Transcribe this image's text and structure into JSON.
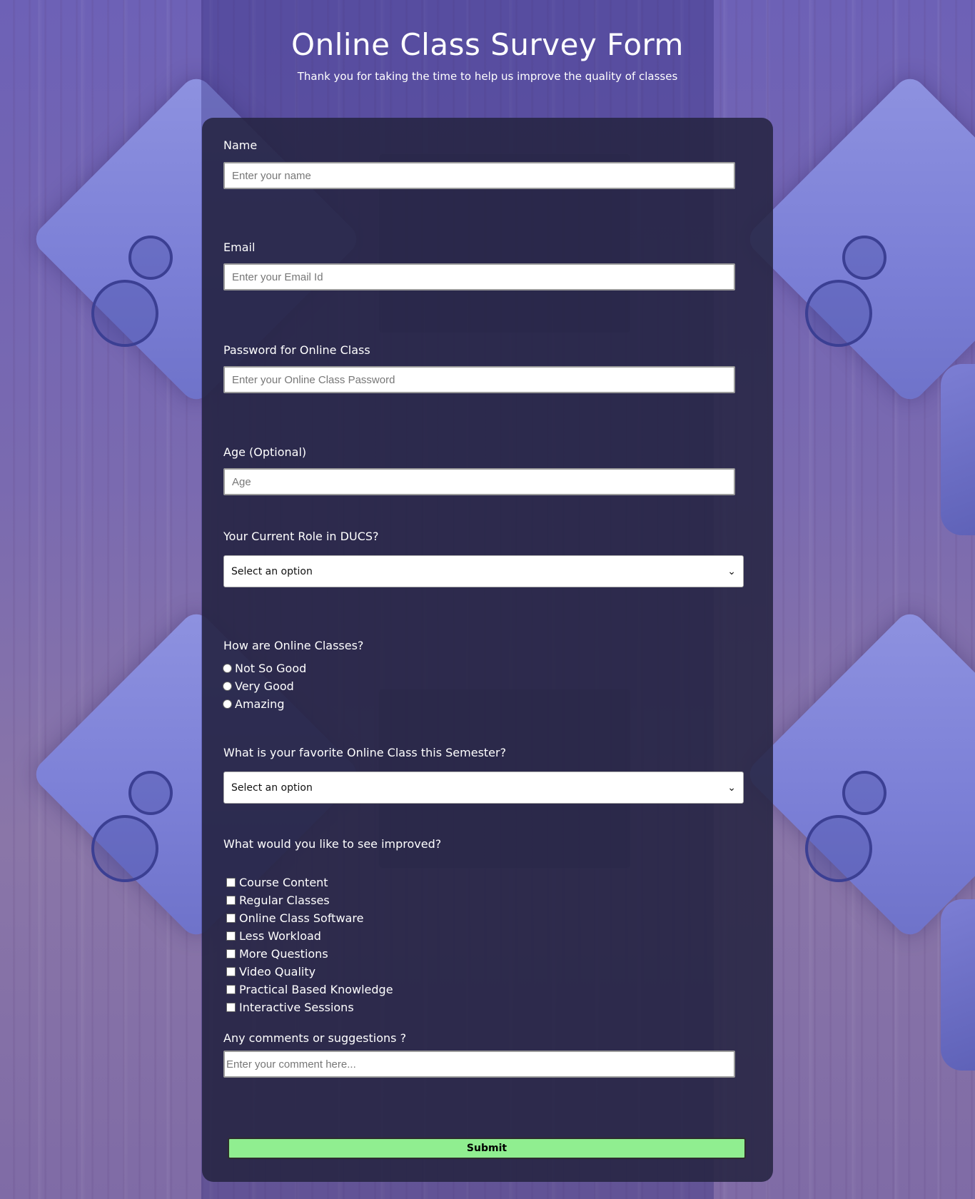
{
  "header": {
    "title": "Online Class Survey Form",
    "subtitle": "Thank you for taking the time to help us improve the quality of classes"
  },
  "form": {
    "name": {
      "label": "Name",
      "placeholder": "Enter your name"
    },
    "email": {
      "label": "Email",
      "placeholder": "Enter your Email Id"
    },
    "password": {
      "label": "Password for Online Class",
      "placeholder": "Enter your Online Class Password"
    },
    "age": {
      "label": "Age (Optional)",
      "placeholder": "Age"
    },
    "role": {
      "label": "Your Current Role in DUCS?",
      "selected": "Select an option"
    },
    "rating": {
      "label": "How are Online Classes?",
      "options": [
        "Not So Good",
        "Very Good",
        "Amazing"
      ]
    },
    "favorite": {
      "label": "What is your favorite Online Class this Semester?",
      "selected": "Select an option"
    },
    "improve": {
      "label": "What would you like to see improved?",
      "options": [
        "Course Content",
        "Regular Classes",
        "Online Class Software",
        "Less Workload",
        "More Questions",
        "Video Quality",
        "Practical Based Knowledge",
        "Interactive Sessions"
      ]
    },
    "comments": {
      "label": "Any comments or suggestions ?",
      "placeholder": "Enter your comment here..."
    },
    "submit_label": "Submit"
  },
  "colors": {
    "card_bg": "#262442",
    "submit_bg": "#90ee90",
    "background_tint": "#6f63b3"
  }
}
